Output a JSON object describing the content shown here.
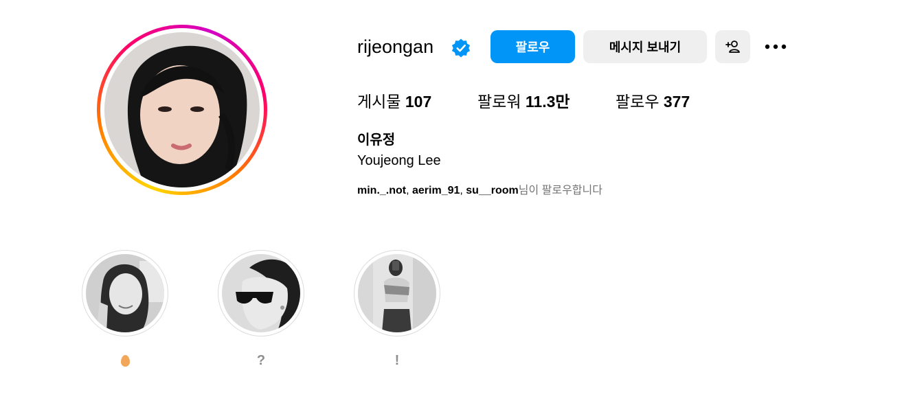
{
  "profile": {
    "username": "rijeongan",
    "verified": true,
    "full_name": "이유정",
    "romanized_name": "Youjeong Lee",
    "accent_color": "#0095f6"
  },
  "actions": {
    "follow_label": "팔로우",
    "message_label": "메시지 보내기",
    "add_user_icon": "add-person-icon",
    "more_icon": "more-horizontal-icon"
  },
  "stats": {
    "posts_label": "게시물",
    "posts_value": "107",
    "followers_label": "팔로워",
    "followers_value": "11.3만",
    "following_label": "팔로우",
    "following_value": "377"
  },
  "followed_by": {
    "accounts": [
      "min._.not",
      "aerim_91",
      "su__room"
    ],
    "suffix": "님이 팔로우합니다"
  },
  "highlights": [
    {
      "label": "🥚",
      "icon": "egg-emoji"
    },
    {
      "label": "?"
    },
    {
      "label": "!"
    }
  ]
}
